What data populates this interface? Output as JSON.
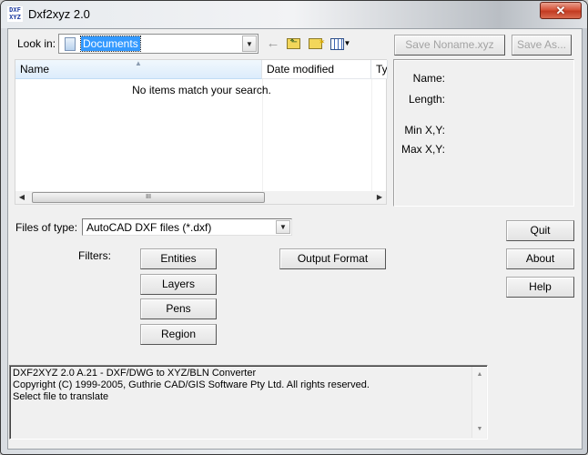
{
  "window": {
    "title": "Dxf2xyz 2.0",
    "app_icon_text": "DXF XYZ",
    "close_glyph": "✕"
  },
  "file_dialog": {
    "look_in_label": "Look in:",
    "look_in_value": "Documents",
    "toolbar": {
      "back_icon": "←",
      "up_icon": "folder-up-icon",
      "new_folder_icon": "new-folder-icon",
      "views_icon": "views-menu-icon"
    },
    "columns": [
      {
        "label": "Name",
        "sorted": "ascending"
      },
      {
        "label": "Date modified"
      },
      {
        "label": "Ty"
      }
    ],
    "empty_message": "No items match your search.",
    "scroll_thumb_grip": "III",
    "files_of_type_label": "Files of type:",
    "files_of_type_value": "AutoCAD DXF files (*.dxf)"
  },
  "save_buttons": {
    "save": "Save Noname.xyz",
    "save_as": "Save As..."
  },
  "info_panel": {
    "name_label": "Name:",
    "length_label": "Length:",
    "min_label": "Min X,Y:",
    "max_label": "Max X,Y:"
  },
  "filters": {
    "label": "Filters:",
    "buttons": [
      "Entities",
      "Layers",
      "Pens",
      "Region"
    ]
  },
  "output_format_button": "Output Format",
  "side_buttons": {
    "quit": "Quit",
    "about": "About",
    "help": "Help"
  },
  "log": {
    "lines": [
      "DXF2XYZ 2.0 A.21  -  DXF/DWG to XYZ/BLN Converter",
      "Copyright (C) 1999-2005, Guthrie CAD/GIS Software Pty Ltd.  All rights reserved.",
      "Select file to translate"
    ]
  }
}
